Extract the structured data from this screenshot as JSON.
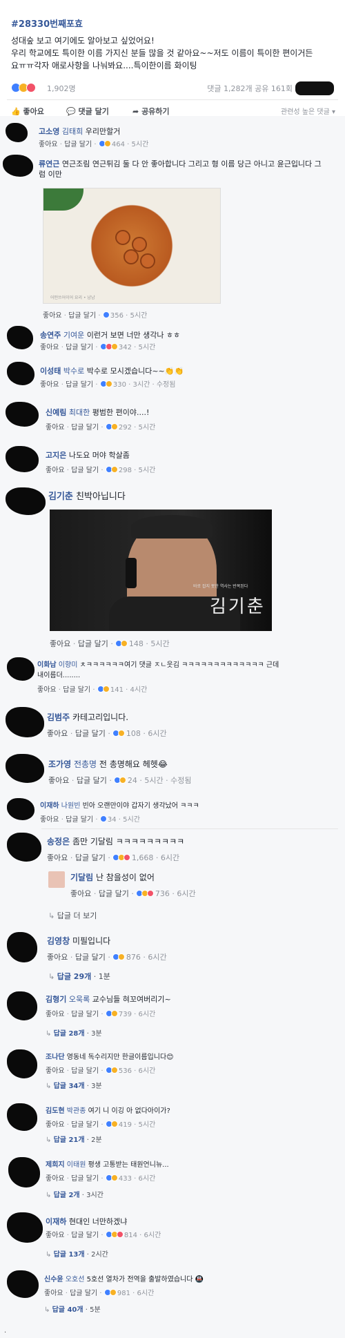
{
  "post": {
    "tag": "#28330번째포효",
    "body_lines": [
      "성대숲 보고 여기에도 알아보고 싶었어요!",
      "우리 학교에도 특이한 이름 가지신 분들 많을 것 같아요~~저도 이름이 특이한 편이거든",
      "요ㅠㅠ각자 애로사항을 나눠봐요....특이한이름 화이팅"
    ],
    "reaction_count": "1,902명",
    "comment_share": "댓글 1,282개 공유 161회"
  },
  "actions": {
    "like": "좋아요",
    "comment": "댓글 달기",
    "share": "공유하기",
    "relevance": "관련성 높은 댓글 ▾"
  },
  "comments": [
    {
      "name": "고소영",
      "tag": "김태희",
      "text": "우리만할거",
      "likes": "464",
      "time": "5시간"
    },
    {
      "name": "류연근",
      "tag": "",
      "text": "연근조림 연근튀김 둘 다 안 좋아합니다 그리고 형 이름 당근 아니고 윤근입니다 그",
      "text2": "럼 이만",
      "likes": "356",
      "time": "5시간"
    },
    {
      "name": "송연주",
      "tag": "기여운",
      "text": "이런거 보면 너만 생각나 ㅎㅎ",
      "likes": "342",
      "time": "5시간"
    },
    {
      "name": "이성태",
      "tag": "박수로",
      "text": "박수로 모시겠습니다~~👏👏",
      "likes": "330",
      "time": "3시간 · 수정됨"
    },
    {
      "name": "신예림",
      "tag": "최대한",
      "text": "평범한 편이야....!",
      "likes": "292",
      "time": "5시간"
    },
    {
      "name": "고지은",
      "tag": "",
      "text": "나도요 머야 학살좀",
      "likes": "298",
      "time": "5시간"
    },
    {
      "name": "김기춘",
      "tag": "",
      "text": "친박아닙니다",
      "likes": "148",
      "time": "5시간",
      "photo_small": "바로 잡지 못한 역사는 반복된다",
      "photo_big": "김기춘"
    },
    {
      "name": "이화남",
      "tag": "이향미",
      "text": "ㅊㅋㅋㅋㅋㅋㅋ여기 댓글 ㅈㄴ웃김 ㅋㅋㅋㅋㅋㅋㅋㅋㅋㅋㅋㅋㅋ 근데",
      "text2": "내이름더........",
      "likes": "141",
      "time": "4시간"
    },
    {
      "name": "김범주",
      "tag": "",
      "text": "카테고리입니다.",
      "likes": "108",
      "time": "6시간"
    },
    {
      "name": "조가영",
      "tag": "전총명",
      "text": "전 총명해요 헤헷😂",
      "likes": "24",
      "time": "5시간 · 수정됨"
    },
    {
      "name": "이재하",
      "tag": "나원빈",
      "text": "빈아 오랜만이야 갑자기 생각났어 ㅋㅋㅋ",
      "likes": "34",
      "time": "5시간"
    },
    {
      "name": "송정은",
      "tag": "",
      "text": "좀만 기달림 ㅋㅋㅋㅋㅋㅋㅋㅋㅋ",
      "likes": "1,668",
      "time": "6시간"
    },
    {
      "name": "기달림",
      "tag": "",
      "text": "난 참을성이 없어",
      "likes": "736",
      "time": "6시간"
    },
    {
      "name": "김영창",
      "tag": "",
      "text": "미필입니다",
      "likes": "876",
      "time": "6시간"
    },
    {
      "name": "김형기",
      "tag": "오욱록",
      "text": "교수님들 혀꼬여버리기~",
      "likes": "739",
      "time": "6시간"
    },
    {
      "name": "조나단",
      "tag": "",
      "text": "영동네 독수리지만 한글이름입니다😊",
      "likes": "536",
      "time": "6시간"
    },
    {
      "name": "김도현",
      "tag": "박관종",
      "text": "여기 니 이깅 아 없다아이가?",
      "likes": "419",
      "time": "5시간"
    },
    {
      "name": "제희지",
      "tag": "이태원",
      "text": "평생 고통받는 태원언니뉴...",
      "likes": "433",
      "time": "6시간"
    },
    {
      "name": "이재하",
      "tag": "",
      "text": "현대인 너만하겠냐",
      "likes": "814",
      "time": "6시간"
    },
    {
      "name": "신수윤",
      "tag": "오호선",
      "text": "5호선 열차가 전역을 출발하였습니다 🚇",
      "likes": "981",
      "time": "6시간"
    }
  ],
  "labels": {
    "like": "좋아요",
    "reply": "답글 달기",
    "more_replies": "답글 더 보기"
  },
  "reply_counts": {
    "r1": "답글 29개",
    "r1_time": "1분",
    "r2": "답글 28개",
    "r2_time": "3분",
    "r3": "답글 34개",
    "r3_time": "3분",
    "r4": "답글 21개",
    "r4_time": "2분",
    "r5": "답글 2개",
    "r5_time": "3시간",
    "r6": "답글 13개",
    "r6_time": "2시간",
    "r7": "답글 40개",
    "r7_time": "5분"
  },
  "lotus_caption": "어떤쓰어이어 요리 • 냠냠"
}
